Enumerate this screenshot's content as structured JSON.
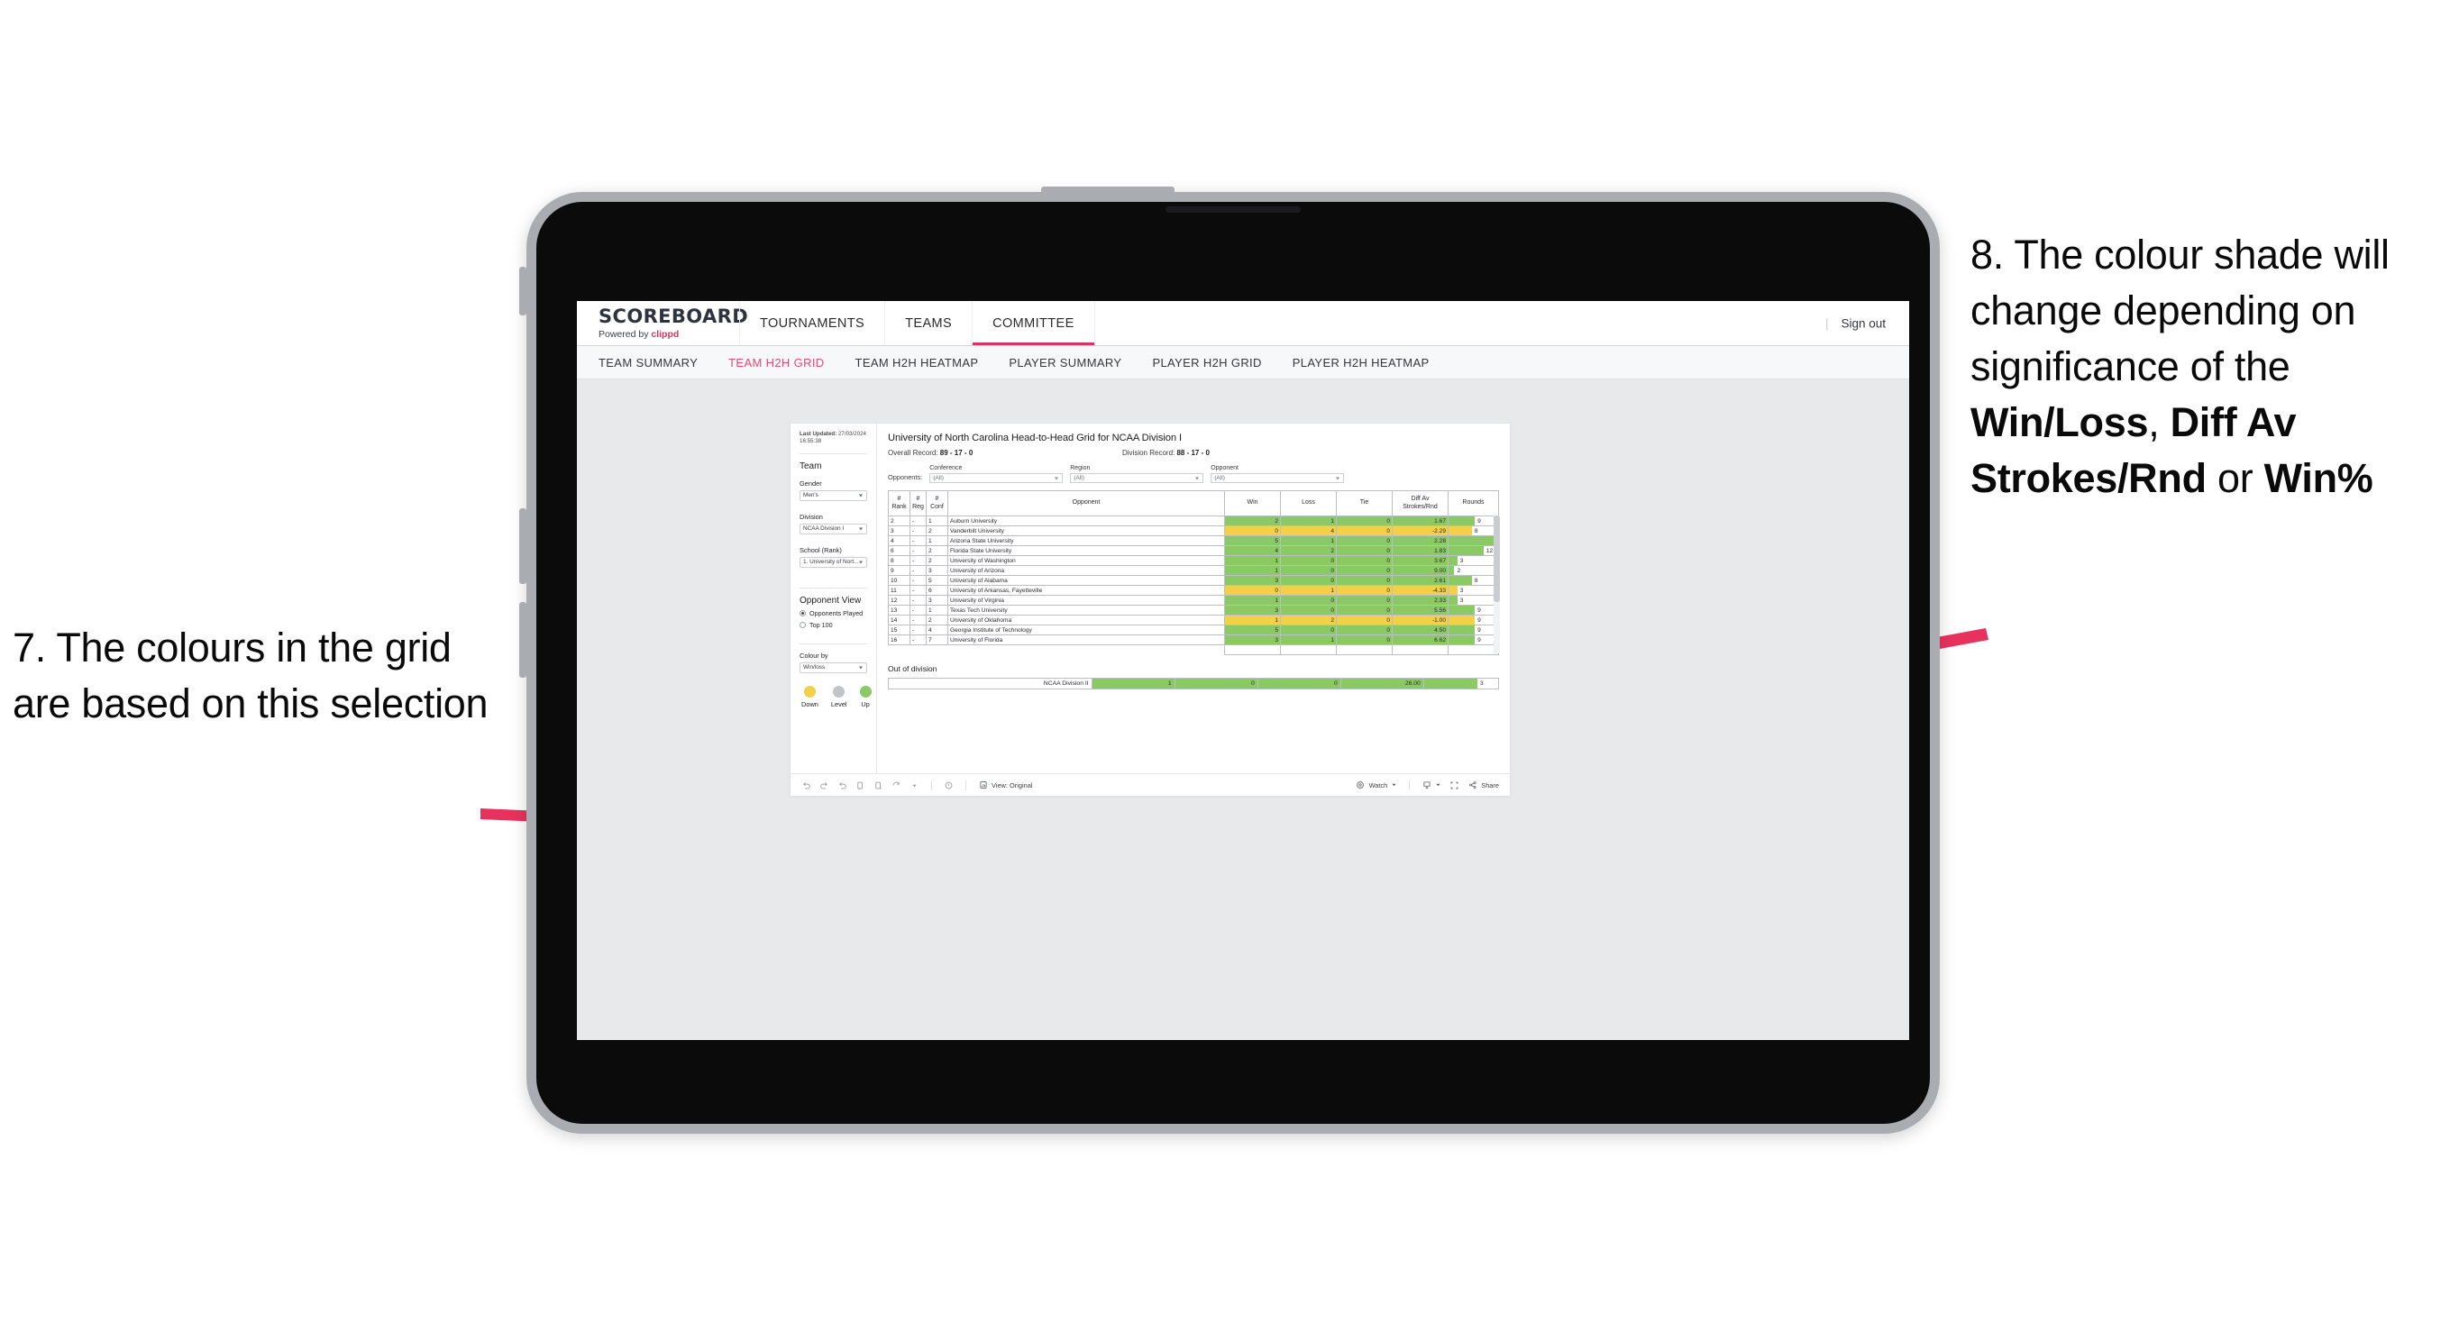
{
  "annotations": {
    "left": "7. The colours in the grid are based on this selection",
    "right_pre": "8. The colour shade will change depending on significance of the ",
    "right_b1": "Win/Loss",
    "right_mid1": ", ",
    "right_b2": "Diff Av Strokes/Rnd",
    "right_mid2": " or ",
    "right_b3": "Win%",
    "accent_color": "#e8325e"
  },
  "app": {
    "brand_title": "SCOREBOARD",
    "brand_sub_prefix": "Powered by ",
    "brand_sub_name": "clippd",
    "nav_tabs": [
      {
        "label": "TOURNAMENTS",
        "active": false
      },
      {
        "label": "TEAMS",
        "active": false
      },
      {
        "label": "COMMITTEE",
        "active": true
      }
    ],
    "sign_out": "Sign out",
    "sub_tabs": [
      {
        "label": "TEAM SUMMARY",
        "active": false
      },
      {
        "label": "TEAM H2H GRID",
        "active": true
      },
      {
        "label": "TEAM H2H HEATMAP",
        "active": false
      },
      {
        "label": "PLAYER SUMMARY",
        "active": false
      },
      {
        "label": "PLAYER H2H GRID",
        "active": false
      },
      {
        "label": "PLAYER H2H HEATMAP",
        "active": false
      }
    ]
  },
  "panel": {
    "last_updated_label": "Last Updated: ",
    "last_updated_value": "27/03/2024 16:55:38",
    "team_heading": "Team",
    "gender_label": "Gender",
    "gender_value": "Men's",
    "division_label": "Division",
    "division_value": "NCAA Division I",
    "school_label": "School (Rank)",
    "school_value": "1. University of Nort...",
    "opponent_view_heading": "Opponent View",
    "opponent_view_options": [
      {
        "label": "Opponents Played",
        "selected": true
      },
      {
        "label": "Top 100",
        "selected": false
      }
    ],
    "colour_by_label": "Colour by",
    "colour_by_value": "Win/loss",
    "legend": [
      {
        "label": "Down",
        "color": "#f2d048"
      },
      {
        "label": "Level",
        "color": "#c2c5c8"
      },
      {
        "label": "Up",
        "color": "#8bc965"
      }
    ]
  },
  "view": {
    "title": "University of North Carolina Head-to-Head Grid for NCAA Division I",
    "overall_record_label": "Overall Record: ",
    "overall_record_value": "89 - 17 - 0",
    "division_record_label": "Division Record: ",
    "division_record_value": "88 - 17 - 0",
    "opponents_label": "Opponents:",
    "filters": [
      {
        "caption": "Conference",
        "value": "(All)"
      },
      {
        "caption": "Region",
        "value": "(All)"
      },
      {
        "caption": "Opponent",
        "value": "(All)"
      }
    ],
    "out_of_division_title": "Out of division"
  },
  "chart_data": {
    "type": "table",
    "title": "University of North Carolina Head-to-Head Grid for NCAA Division I",
    "columns": [
      "# Rank",
      "# Reg",
      "# Conf",
      "Opponent",
      "Win",
      "Loss",
      "Tie",
      "Diff Av Strokes/Rnd",
      "Rounds"
    ],
    "column_headers_multiline": [
      [
        "#",
        "Rank"
      ],
      [
        "#",
        "Reg"
      ],
      [
        "#",
        "Conf"
      ],
      [
        "Opponent"
      ],
      [
        "Win"
      ],
      [
        "Loss"
      ],
      [
        "Tie"
      ],
      [
        "Diff Av",
        "Strokes/Rnd"
      ],
      [
        "Rounds"
      ]
    ],
    "colour_legend": {
      "up": "#8bc965",
      "down": "#f2d048",
      "level": "#c2c5c8"
    },
    "rounds_max": 17,
    "rows": [
      {
        "rank": "2",
        "reg": "-",
        "conf": "1",
        "opponent": "Auburn University",
        "win": "2",
        "loss": "1",
        "tie": "0",
        "diff": "1.67",
        "rounds": 9,
        "rounds_label": "9",
        "color": "#8bc965"
      },
      {
        "rank": "3",
        "reg": "-",
        "conf": "2",
        "opponent": "Vanderbilt University",
        "win": "0",
        "loss": "4",
        "tie": "0",
        "diff": "-2.29",
        "rounds": 8,
        "rounds_label": "8",
        "color": "#f2d048"
      },
      {
        "rank": "4",
        "reg": "-",
        "conf": "1",
        "opponent": "Arizona State University",
        "win": "5",
        "loss": "1",
        "tie": "0",
        "diff": "2.28",
        "rounds": 17,
        "rounds_label": "17",
        "color": "#8bc965"
      },
      {
        "rank": "6",
        "reg": "-",
        "conf": "2",
        "opponent": "Florida State University",
        "win": "4",
        "loss": "2",
        "tie": "0",
        "diff": "1.83",
        "rounds": 12,
        "rounds_label": "12",
        "color": "#8bc965"
      },
      {
        "rank": "8",
        "reg": "-",
        "conf": "2",
        "opponent": "University of Washington",
        "win": "1",
        "loss": "0",
        "tie": "0",
        "diff": "3.67",
        "rounds": 3,
        "rounds_label": "3",
        "color": "#8bc965"
      },
      {
        "rank": "9",
        "reg": "-",
        "conf": "3",
        "opponent": "University of Arizona",
        "win": "1",
        "loss": "0",
        "tie": "0",
        "diff": "9.00",
        "rounds": 2,
        "rounds_label": "2",
        "color": "#8bc965"
      },
      {
        "rank": "10",
        "reg": "-",
        "conf": "5",
        "opponent": "University of Alabama",
        "win": "3",
        "loss": "0",
        "tie": "0",
        "diff": "2.61",
        "rounds": 8,
        "rounds_label": "8",
        "color": "#8bc965"
      },
      {
        "rank": "11",
        "reg": "-",
        "conf": "6",
        "opponent": "University of Arkansas, Fayetteville",
        "win": "0",
        "loss": "1",
        "tie": "0",
        "diff": "-4.33",
        "rounds": 3,
        "rounds_label": "3",
        "color": "#f2d048"
      },
      {
        "rank": "12",
        "reg": "-",
        "conf": "3",
        "opponent": "University of Virginia",
        "win": "1",
        "loss": "0",
        "tie": "0",
        "diff": "2.33",
        "rounds": 3,
        "rounds_label": "3",
        "color": "#8bc965"
      },
      {
        "rank": "13",
        "reg": "-",
        "conf": "1",
        "opponent": "Texas Tech University",
        "win": "3",
        "loss": "0",
        "tie": "0",
        "diff": "5.56",
        "rounds": 9,
        "rounds_label": "9",
        "color": "#8bc965"
      },
      {
        "rank": "14",
        "reg": "-",
        "conf": "2",
        "opponent": "University of Oklahoma",
        "win": "1",
        "loss": "2",
        "tie": "0",
        "diff": "-1.00",
        "rounds": 9,
        "rounds_label": "9",
        "color": "#f2d048"
      },
      {
        "rank": "15",
        "reg": "-",
        "conf": "4",
        "opponent": "Georgia Institute of Technology",
        "win": "5",
        "loss": "0",
        "tie": "0",
        "diff": "4.50",
        "rounds": 9,
        "rounds_label": "9",
        "color": "#8bc965"
      },
      {
        "rank": "16",
        "reg": "-",
        "conf": "7",
        "opponent": "University of Florida",
        "win": "3",
        "loss": "1",
        "tie": "0",
        "diff": "6.62",
        "rounds": 9,
        "rounds_label": "9",
        "color": "#8bc965"
      }
    ],
    "out_of_division": {
      "label": "NCAA Division II",
      "win": "1",
      "loss": "0",
      "tie": "0",
      "diff": "26.00",
      "rounds": 3,
      "rounds_label": "3",
      "color": "#8bc965"
    }
  },
  "toolbar": {
    "view_label": "View: Original",
    "watch_label": "Watch",
    "share_label": "Share",
    "icons": [
      "undo-icon",
      "redo-icon",
      "revert-icon",
      "refresh-icon",
      "pause-icon",
      "custom-view-icon",
      "alert-icon",
      "view-icon",
      "watch-icon",
      "download-icon",
      "fullscreen-icon",
      "share-icon"
    ]
  }
}
